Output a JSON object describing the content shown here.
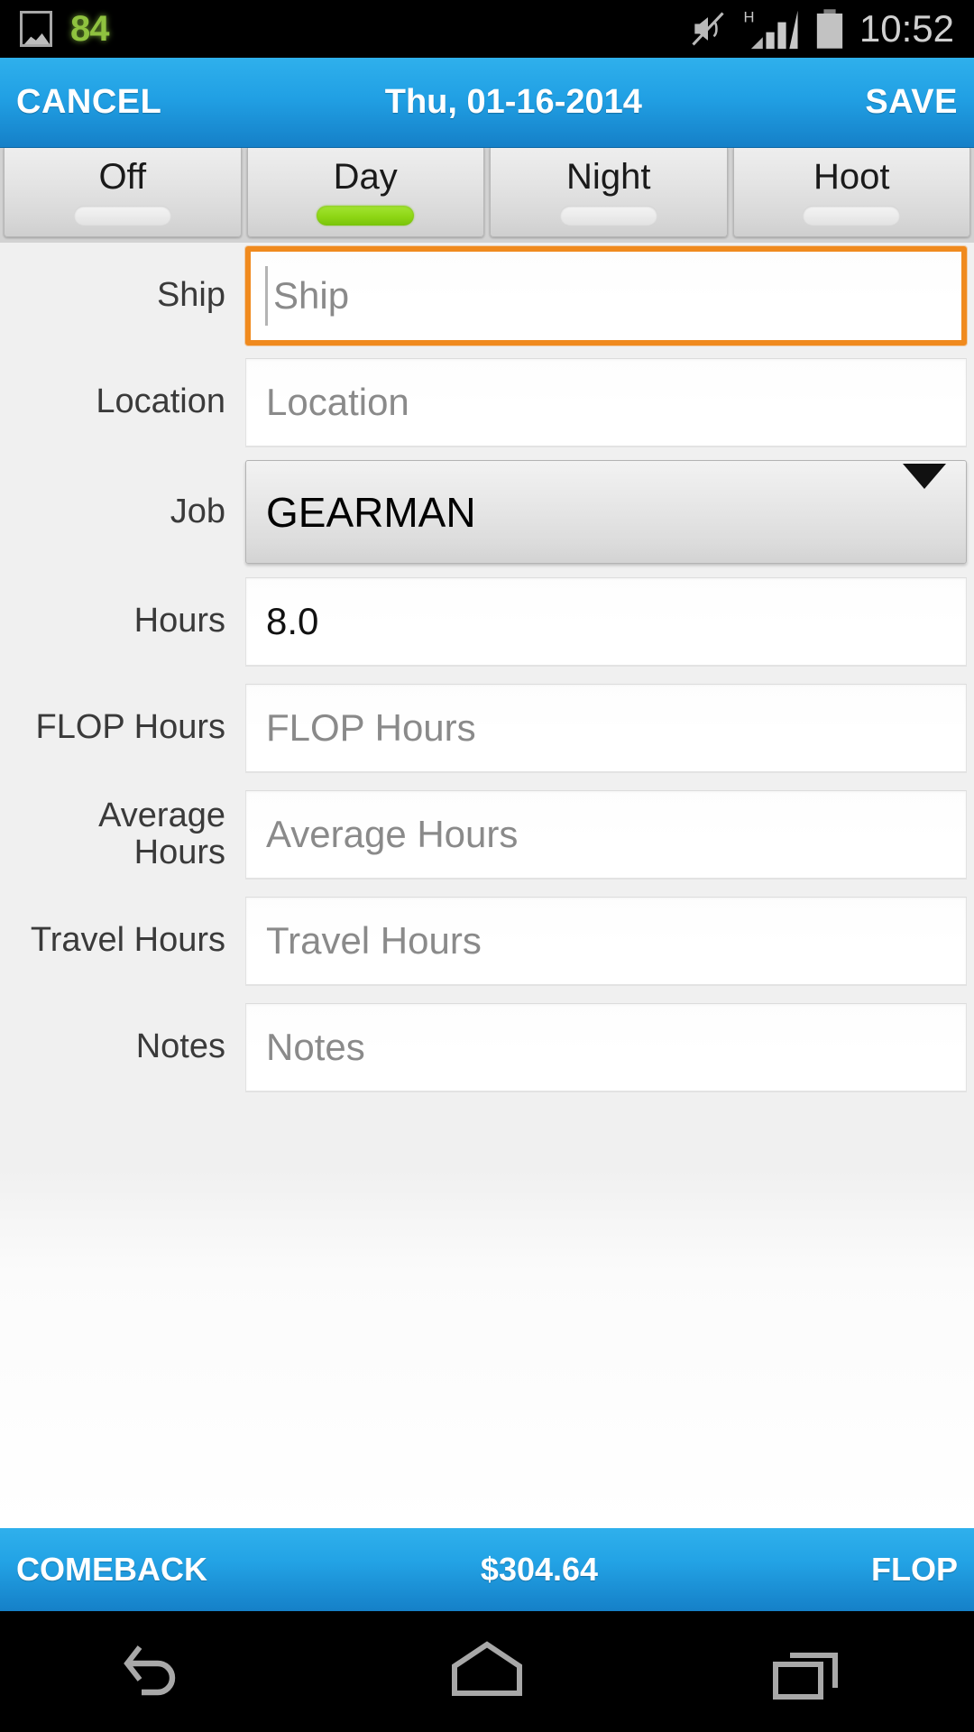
{
  "statusbar": {
    "gallery_icon": "image-icon",
    "notification_count": "84",
    "mute_icon": "volume-mute-icon",
    "network_label": "H",
    "signal_icon": "signal-bars-icon",
    "battery_icon": "battery-full-icon",
    "time": "10:52"
  },
  "actionbar": {
    "cancel_label": "CANCEL",
    "title": "Thu, 01-16-2014",
    "save_label": "SAVE"
  },
  "tabs": [
    {
      "label": "Off",
      "selected": false
    },
    {
      "label": "Day",
      "selected": true
    },
    {
      "label": "Night",
      "selected": false
    },
    {
      "label": "Hoot",
      "selected": false
    }
  ],
  "form": {
    "ship": {
      "label": "Ship",
      "placeholder": "Ship",
      "value": "",
      "focused": true
    },
    "location": {
      "label": "Location",
      "placeholder": "Location",
      "value": ""
    },
    "job": {
      "label": "Job",
      "selected": "GEARMAN",
      "arrow_icon": "chevron-down-icon"
    },
    "hours": {
      "label": "Hours",
      "placeholder": "Hours",
      "value": "8.0"
    },
    "flop_hours": {
      "label": "FLOP Hours",
      "placeholder": "FLOP Hours",
      "value": ""
    },
    "average_hours": {
      "label": "Average Hours",
      "placeholder": "Average Hours",
      "value": ""
    },
    "travel_hours": {
      "label": "Travel Hours",
      "placeholder": "Travel Hours",
      "value": ""
    },
    "notes": {
      "label": "Notes",
      "placeholder": "Notes",
      "value": ""
    }
  },
  "bottombar": {
    "comeback_label": "COMEBACK",
    "total": "$304.64",
    "flop_label": "FLOP"
  },
  "navbar": {
    "back_icon": "back-arrow-icon",
    "home_icon": "home-icon",
    "recents_icon": "recent-apps-icon"
  },
  "colors": {
    "accent_blue": "#21a0e4",
    "focus_orange": "#f08a1e",
    "selected_green": "#8ed615",
    "notification_green": "#8fc23f"
  }
}
